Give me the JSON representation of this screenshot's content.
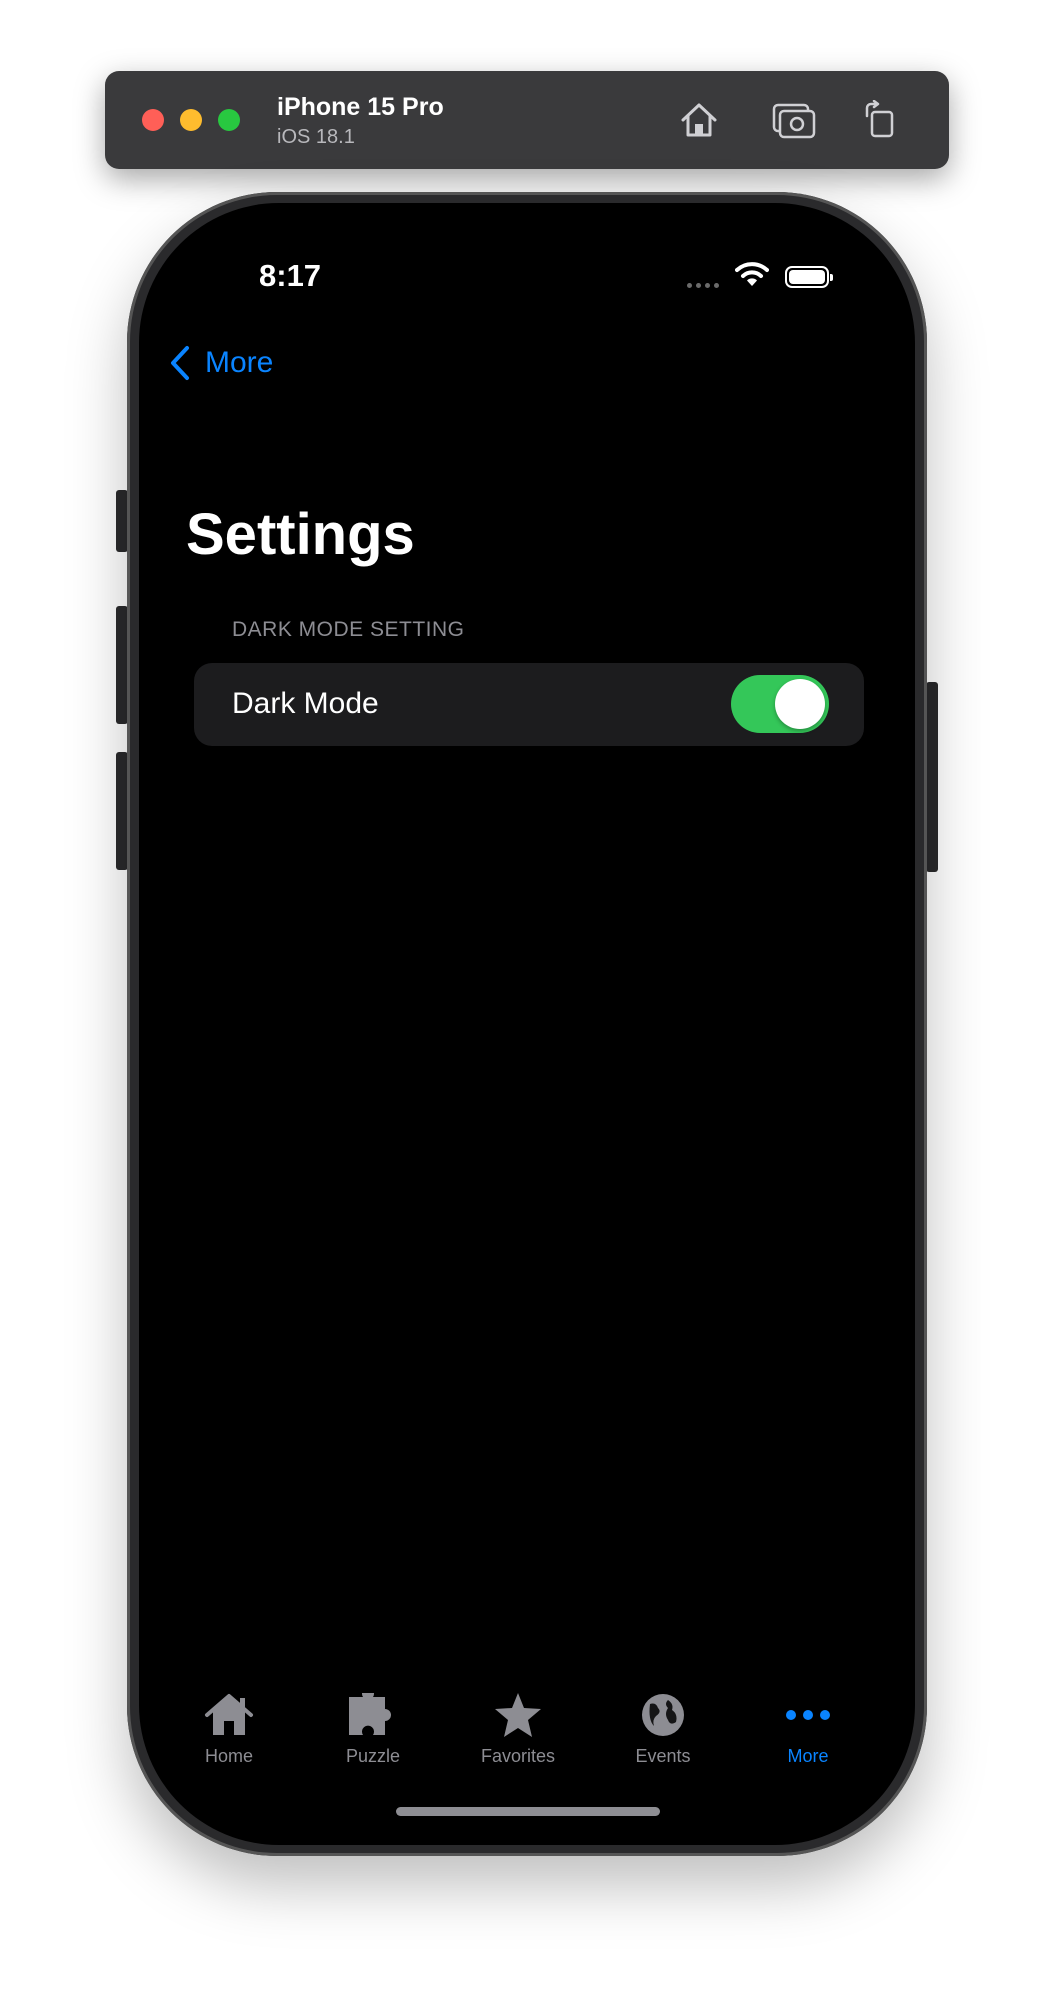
{
  "simulator": {
    "device_name": "iPhone 15 Pro",
    "os_version": "iOS 18.1",
    "icons": [
      "home-icon",
      "screenshot-icon",
      "rotate-icon"
    ]
  },
  "status_bar": {
    "time": "8:17",
    "icons": [
      "cellular-dots-icon",
      "wifi-icon",
      "battery-icon"
    ]
  },
  "nav": {
    "back_label": "More",
    "back_icon": "chevron-left-icon"
  },
  "page": {
    "title": "Settings",
    "section_header": "DARK MODE SETTING",
    "rows": [
      {
        "label": "Dark Mode",
        "toggle_on": true
      }
    ]
  },
  "tab_bar": {
    "tabs": [
      {
        "label": "Home",
        "icon": "house-icon",
        "active": false
      },
      {
        "label": "Puzzle",
        "icon": "puzzle-piece-icon",
        "active": false
      },
      {
        "label": "Favorites",
        "icon": "star-icon",
        "active": false
      },
      {
        "label": "Events",
        "icon": "globe-icon",
        "active": false
      },
      {
        "label": "More",
        "icon": "ellipsis-icon",
        "active": true
      }
    ]
  },
  "colors": {
    "accent": "#0a84ff",
    "toggle_on": "#34c759",
    "background": "#000000",
    "row_background": "#1c1c1e",
    "inactive_tab": "#8d8d93"
  }
}
